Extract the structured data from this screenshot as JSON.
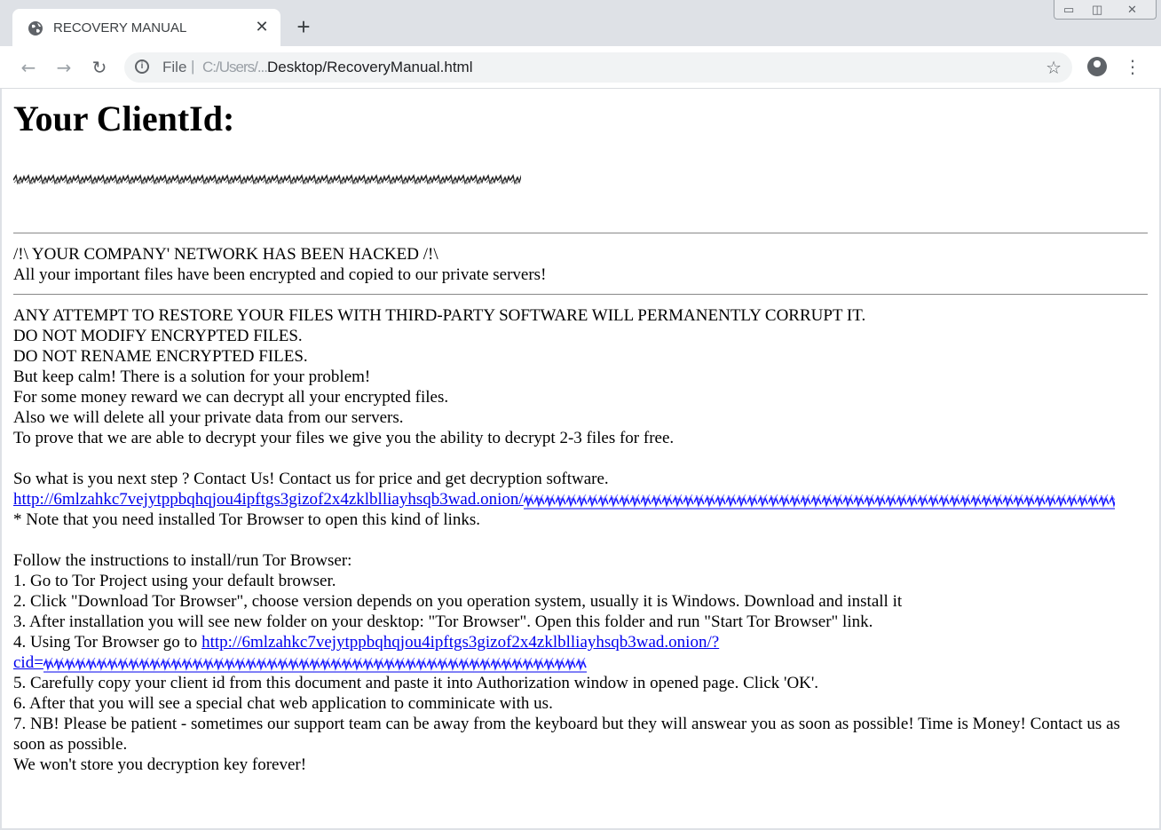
{
  "browser": {
    "tab_title": "RECOVERY MANUAL",
    "address": {
      "scheme": "File",
      "path_redacted": "C:/Users/...",
      "path_visible": "Desktop/RecoveryManual.html"
    }
  },
  "page": {
    "heading": "Your ClientId:",
    "notice_title": "/!\\ YOUR COMPANY' NETWORK HAS BEEN HACKED /!\\",
    "notice_body": "All your important files have been encrypted and copied to our private servers!",
    "warnings": [
      "ANY ATTEMPT TO RESTORE YOUR FILES WITH THIRD-PARTY SOFTWARE WILL PERMANENTLY CORRUPT IT.",
      "DO NOT MODIFY ENCRYPTED FILES.",
      "DO NOT RENAME ENCRYPTED FILES.",
      "But keep calm! There is a solution for your problem!",
      "For some money reward we can decrypt all your encrypted files.",
      "Also we will delete all your private data from our servers.",
      "To prove that we are able to decrypt your files we give you the ability to decrypt 2-3 files for free."
    ],
    "next_step": "So what is you next step ? Contact Us! Contact us for price and get decryption software.",
    "onion_link": "http://6mlzahkc7vejytppbqhqjou4ipftgs3gizof2x4zklblliayhsqb3wad.onion/",
    "tor_note": "* Note that you need installed Tor Browser to open this kind of links.",
    "instructions_title": "Follow the instructions to install/run Tor Browser:",
    "step1": "1. Go to Tor Project using your default browser.",
    "step2": "2. Click \"Download Tor Browser\", choose version depends on you operation system, usually it is Windows. Download and install it",
    "step3": "3. After installation you will see new folder on your desktop: \"Tor Browser\". Open this folder and run \"Start Tor Browser\" link.",
    "step4_prefix": "4. Using Tor Browser go to ",
    "step4_link": "http://6mlzahkc7vejytppbqhqjou4ipftgs3gizof2x4zklblliayhsqb3wad.onion/?",
    "step4_link_cont": "cid=",
    "step5": "5. Carefully copy your client id from this document and paste it into Authorization window in opened page. Click 'OK'.",
    "step6": "6. After that you will see a special chat web application to comminicate with us.",
    "step7": "7. NB! Please be patient - sometimes our support team can be away from the keyboard but they will answear you as soon as possible! Time is Money! Contact us as soon as possible.",
    "closing": "We won't store you decryption key forever!"
  },
  "icons": {
    "tab": "globe-icon",
    "close": "close-icon",
    "new_tab": "plus-icon",
    "back": "back-arrow-icon",
    "forward": "forward-arrow-icon",
    "reload": "reload-icon",
    "info": "info-icon",
    "bookmark": "star-icon",
    "profile": "profile-icon",
    "menu": "kebab-menu-icon"
  },
  "colors": {
    "link": "#0000ee",
    "chrome": "#dee1e6"
  }
}
